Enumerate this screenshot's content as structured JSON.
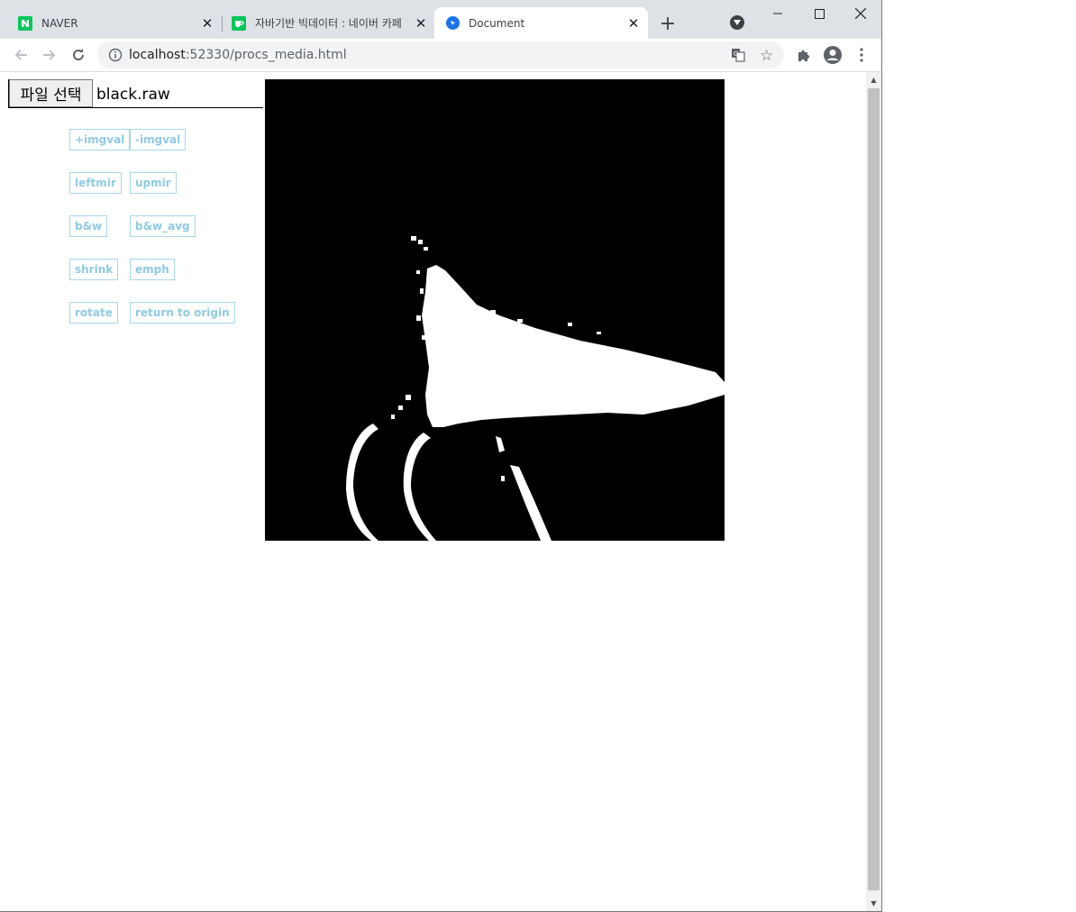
{
  "tabs": [
    {
      "title": "NAVER",
      "favicon": "naver-n-icon",
      "color": "#03c75a",
      "active": false
    },
    {
      "title": "자바기반 빅데이터 : 네이버 카페",
      "favicon": "naver-cafe-icon",
      "color": "#03c75a",
      "active": false
    },
    {
      "title": "Document",
      "favicon": "document-globe-icon",
      "color": "#5f6368",
      "active": true
    }
  ],
  "address_bar": {
    "host": "localhost",
    "rest": ":52330/procs_media.html"
  },
  "file_input": {
    "button_label": "파일 선택",
    "filename": "black.raw"
  },
  "buttons": {
    "add_imgval": "+imgval",
    "sub_imgval": "-imgval",
    "leftmir": "leftmir",
    "upmir": "upmir",
    "bw": "b&w",
    "bw_avg": "b&w_avg",
    "shrink": "shrink",
    "emph": "emph",
    "rotate": "rotate",
    "return_origin": "return to origin"
  },
  "colors": {
    "button_text": "#8fcae3",
    "button_border": "#a7d6ea",
    "tabstrip": "#dee1e6"
  }
}
